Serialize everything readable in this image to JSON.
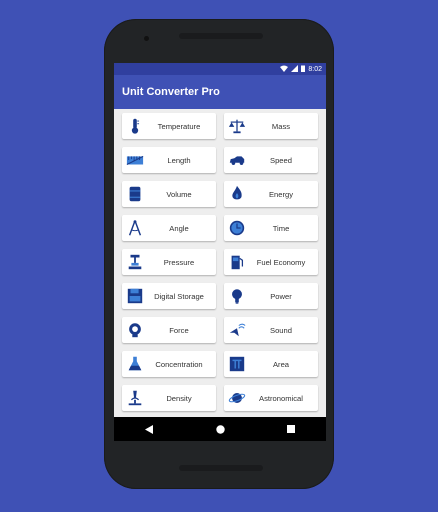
{
  "status": {
    "time": "8:02"
  },
  "app": {
    "title": "Unit Converter Pro"
  },
  "categories": [
    {
      "label": "Temperature",
      "icon": "thermometer-icon"
    },
    {
      "label": "Mass",
      "icon": "scale-icon"
    },
    {
      "label": "Length",
      "icon": "ruler-icon"
    },
    {
      "label": "Speed",
      "icon": "car-icon"
    },
    {
      "label": "Volume",
      "icon": "barrel-icon"
    },
    {
      "label": "Energy",
      "icon": "flame-icon"
    },
    {
      "label": "Angle",
      "icon": "compass-icon"
    },
    {
      "label": "Time",
      "icon": "clock-icon"
    },
    {
      "label": "Pressure",
      "icon": "press-icon"
    },
    {
      "label": "Fuel Economy",
      "icon": "fuel-pump-icon"
    },
    {
      "label": "Digital Storage",
      "icon": "floppy-icon"
    },
    {
      "label": "Power",
      "icon": "bulb-icon"
    },
    {
      "label": "Force",
      "icon": "magnet-icon"
    },
    {
      "label": "Sound",
      "icon": "speaker-icon"
    },
    {
      "label": "Concentration",
      "icon": "flask-icon"
    },
    {
      "label": "Area",
      "icon": "pi-icon"
    },
    {
      "label": "Density",
      "icon": "microscope-icon"
    },
    {
      "label": "Astronomical",
      "icon": "planet-icon"
    }
  ],
  "colors": {
    "primary": "#3f51b5",
    "primary_dark": "#303f9f",
    "icon": "#1a3a8a",
    "icon_light": "#3d7fd6"
  }
}
